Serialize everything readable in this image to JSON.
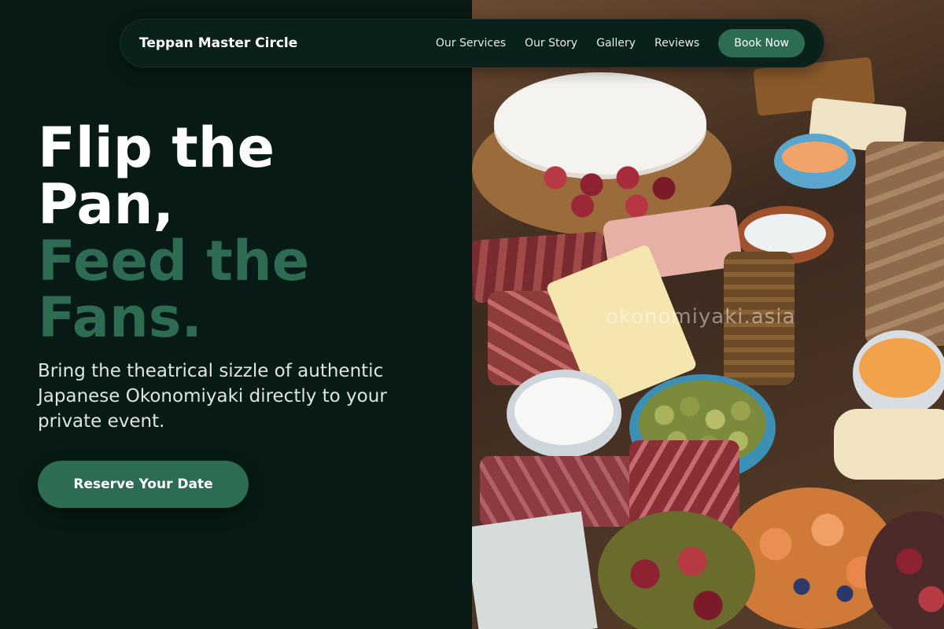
{
  "nav": {
    "brand": "Teppan Master Circle",
    "links": [
      {
        "label": "Our Services"
      },
      {
        "label": "Our Story"
      },
      {
        "label": "Gallery"
      },
      {
        "label": "Reviews"
      }
    ],
    "book_label": "Book Now"
  },
  "hero": {
    "line1": "Flip the",
    "line2": "Pan,",
    "line3": "Feed the",
    "line4": "Fans.",
    "subtitle": "Bring the theatrical sizzle of authentic Japanese Okonomiyaki directly to your private event.",
    "cta_label": "Reserve Your Date"
  },
  "photo": {
    "watermark": "okonomiyaki.asia"
  },
  "colors": {
    "background": "#071a16",
    "accent": "#2e6b53",
    "text": "#ffffff"
  }
}
